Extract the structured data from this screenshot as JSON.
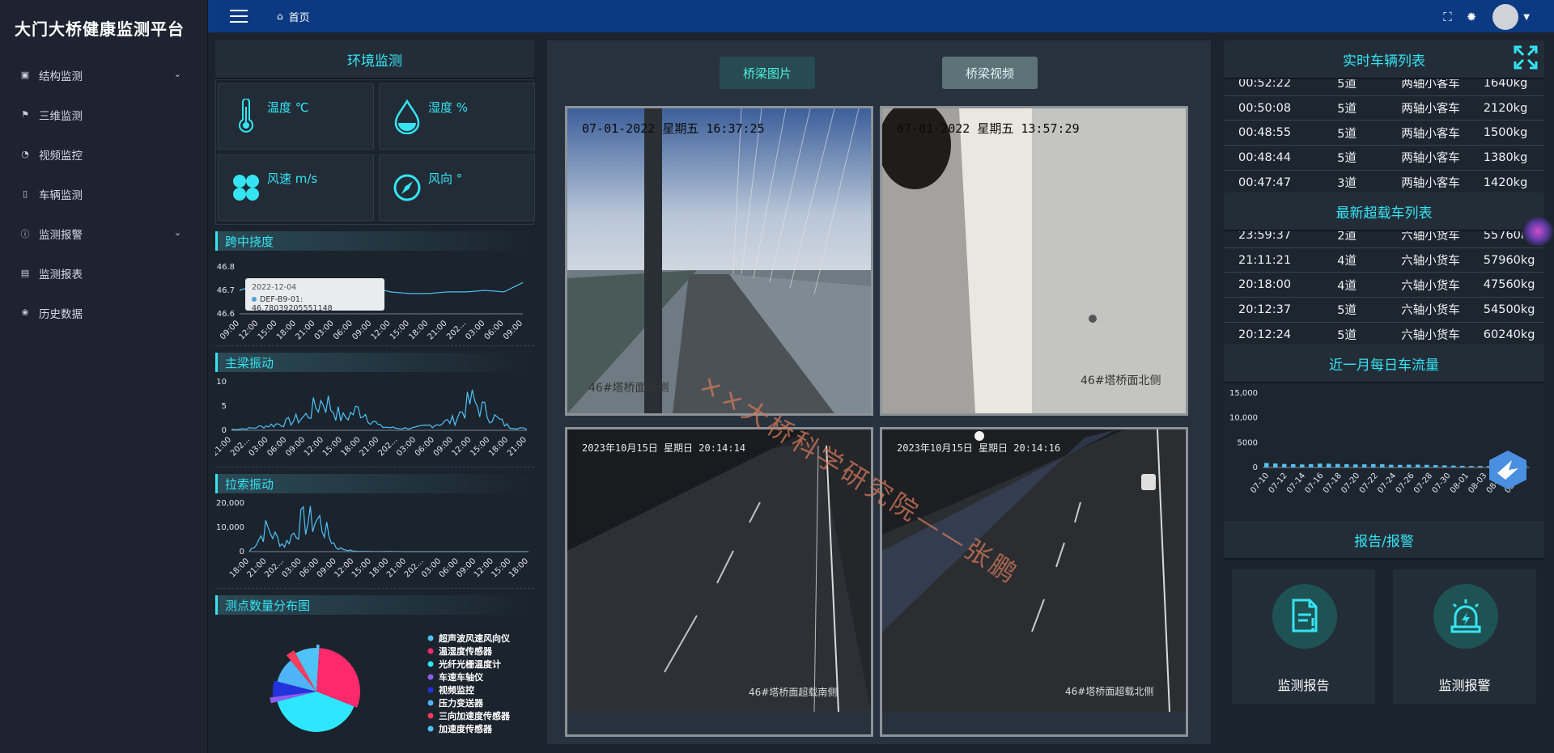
{
  "app": {
    "title": "大门大桥健康监测平台"
  },
  "sidebar": {
    "items": [
      {
        "label": "结构监测",
        "icon": "chart-icon",
        "has_children": true
      },
      {
        "label": "三维监测",
        "icon": "flag-icon",
        "has_children": false
      },
      {
        "label": "视频监控",
        "icon": "video-icon",
        "has_children": false
      },
      {
        "label": "车辆监测",
        "icon": "phone-icon",
        "has_children": false
      },
      {
        "label": "监测报警",
        "icon": "info-icon",
        "has_children": true
      },
      {
        "label": "监测报表",
        "icon": "report-icon",
        "has_children": false
      },
      {
        "label": "历史数据",
        "icon": "paw-icon",
        "has_children": false
      }
    ]
  },
  "topbar": {
    "breadcrumb": "首页",
    "icons": [
      "fullscreen-icon",
      "bug-icon",
      "avatar",
      "caret-down-icon"
    ]
  },
  "environment": {
    "title": "环境监测",
    "cells": [
      {
        "label": "温度 ℃",
        "icon": "thermometer-icon"
      },
      {
        "label": "湿度 %",
        "icon": "droplet-icon"
      },
      {
        "label": "风速 m/s",
        "icon": "fan-icon"
      },
      {
        "label": "风向 °",
        "icon": "compass-icon"
      }
    ]
  },
  "deflection": {
    "title": "跨中挠度",
    "tooltip": {
      "date": "2022-12-04",
      "series": "DEF-B9-01",
      "value": "46.78039205551148"
    }
  },
  "girder_vibration": {
    "title": "主梁振动"
  },
  "cable_vibration": {
    "title": "拉索振动"
  },
  "sensor_distribution": {
    "title": "测点数量分布图",
    "legend": [
      "超声波风速风向仪",
      "温湿度传感器",
      "光纤光栅温度计",
      "车速车轴仪",
      "视频监控",
      "压力变送器",
      "三向加速度传感器",
      "加速度传感器"
    ]
  },
  "center": {
    "tabs": {
      "images": "桥梁图片",
      "videos": "桥梁视频"
    },
    "cameras": [
      {
        "timestamp": "07-01-2022 星期五 16:37:25",
        "label": "46#塔桥面南侧"
      },
      {
        "timestamp": "07-01-2022 星期五 13:57:29",
        "label": "46#塔桥面北侧"
      },
      {
        "timestamp": "2023年10月15日 星期日 20:14:14",
        "label": "46#塔桥面超载南侧"
      },
      {
        "timestamp": "2023年10月15日 星期日 20:14:16",
        "label": "46#塔桥面超载北侧"
      }
    ],
    "watermark": "××大桥科学研究院——张鹏"
  },
  "realtime_vehicles": {
    "title": "实时车辆列表",
    "rows": [
      [
        "00:52:22",
        "5道",
        "两轴小客车",
        "1640kg"
      ],
      [
        "00:50:08",
        "5道",
        "两轴小客车",
        "2120kg"
      ],
      [
        "00:48:55",
        "5道",
        "两轴小客车",
        "1500kg"
      ],
      [
        "00:48:44",
        "5道",
        "两轴小客车",
        "1380kg"
      ],
      [
        "00:47:47",
        "3道",
        "两轴小客车",
        "1420kg"
      ]
    ]
  },
  "overload_vehicles": {
    "title": "最新超载车列表",
    "rows": [
      [
        "23:59:37",
        "2道",
        "六轴小货车",
        "55760kg"
      ],
      [
        "21:11:21",
        "4道",
        "六轴小货车",
        "57960kg"
      ],
      [
        "20:18:00",
        "4道",
        "六轴小货车",
        "47560kg"
      ],
      [
        "20:12:37",
        "5道",
        "六轴小货车",
        "54500kg"
      ],
      [
        "20:12:24",
        "5道",
        "六轴小货车",
        "60240kg"
      ]
    ]
  },
  "daily_traffic": {
    "title": "近一月每日车流量"
  },
  "reports": {
    "title": "报告/报警",
    "cards": [
      {
        "label": "监测报告",
        "icon": "report-doc-icon"
      },
      {
        "label": "监测报警",
        "icon": "alarm-icon"
      }
    ]
  },
  "colors": {
    "accent": "#35e4f3",
    "navbar": "#0b3a82",
    "panel": "#232d38",
    "background": "#1b232d",
    "series": "#4fc3f7"
  },
  "chart_data": [
    {
      "type": "line",
      "title": "跨中挠度",
      "yticks": [
        "46.8",
        "46.7",
        "46.6"
      ],
      "ylim": [
        46.55,
        46.85
      ],
      "categories": [
        "09:00",
        "12:00",
        "15:00",
        "18:00",
        "21:00",
        "03:00",
        "06:00",
        "09:00",
        "12:00",
        "15:00",
        "18:00",
        "21:00",
        "202...",
        "03:00",
        "06:00",
        "09:00"
      ],
      "series": [
        {
          "values": [
            46.7,
            46.74,
            46.76,
            46.77,
            46.76,
            46.75,
            46.74,
            46.72,
            46.69,
            46.68,
            46.68,
            46.69,
            46.69,
            46.7,
            46.69,
            46.75
          ]
        }
      ],
      "grid": false
    },
    {
      "type": "line",
      "title": "主梁振动",
      "yticks": [
        "10",
        "5",
        "0"
      ],
      "ylim": [
        0,
        10
      ],
      "categories": [
        "21:00",
        "202...",
        "03:00",
        "06:00",
        "09:00",
        "12:00",
        "15:00",
        "18:00",
        "21:00",
        "202...",
        "03:00",
        "06:00",
        "09:00",
        "12:00",
        "15:00",
        "18:00",
        "21:00"
      ],
      "series": [
        {
          "values": [
            0.2,
            0.5,
            1.2,
            2.0,
            3.5,
            8.0,
            3.0,
            5.5,
            1.0,
            0.5,
            0.6,
            1.5,
            2.5,
            7.5,
            4.0,
            1.0,
            0.3
          ]
        }
      ],
      "grid": false
    },
    {
      "type": "line",
      "title": "拉索振动",
      "yticks": [
        "20,000",
        "10,000",
        "0"
      ],
      "ylim": [
        0,
        20000
      ],
      "categories": [
        "18:00",
        "21:00",
        "202...",
        "03:00",
        "06:00",
        "09:00",
        "12:00",
        "15:00",
        "18:00",
        "21:00",
        "202...",
        "03:00",
        "06:00",
        "09:00",
        "12:00",
        "15:00",
        "18:00"
      ],
      "series": [
        {
          "values": [
            0,
            12000,
            3000,
            15000,
            16000,
            2000,
            200,
            100,
            100,
            0,
            0,
            0,
            0,
            0,
            0,
            0,
            0
          ]
        }
      ],
      "grid": false
    },
    {
      "type": "bar",
      "title": "近一月每日车流量",
      "yticks": [
        "15,000",
        "10,000",
        "5000",
        "0"
      ],
      "ylim": [
        0,
        15000
      ],
      "categories": [
        "07-10",
        "07-12",
        "07-14",
        "07-16",
        "07-18",
        "07-20",
        "07-22",
        "07-24",
        "07-26",
        "07-28",
        "07-30",
        "08-01",
        "08-03",
        "08-05",
        "08-07"
      ],
      "series": [
        {
          "values": [
            900,
            700,
            600,
            800,
            700,
            600,
            700,
            500,
            600,
            500,
            400,
            300,
            300,
            200,
            500
          ]
        }
      ],
      "grid": false
    },
    {
      "type": "pie",
      "title": "测点数量分布图",
      "categories": [
        "超声波风速风向仪",
        "温湿度传感器",
        "光纤光栅温度计",
        "车速车轴仪",
        "视频监控",
        "压力变送器",
        "三向加速度传感器",
        "加速度传感器"
      ],
      "values": [
        1,
        30,
        40,
        2,
        6,
        10,
        3,
        8
      ],
      "colors": [
        "#4fc3f7",
        "#ff2a6d",
        "#2ee6ff",
        "#8e5cf0",
        "#2233dd",
        "#4fb3f7",
        "#ff3b5c",
        "#4fc3f7"
      ]
    }
  ]
}
